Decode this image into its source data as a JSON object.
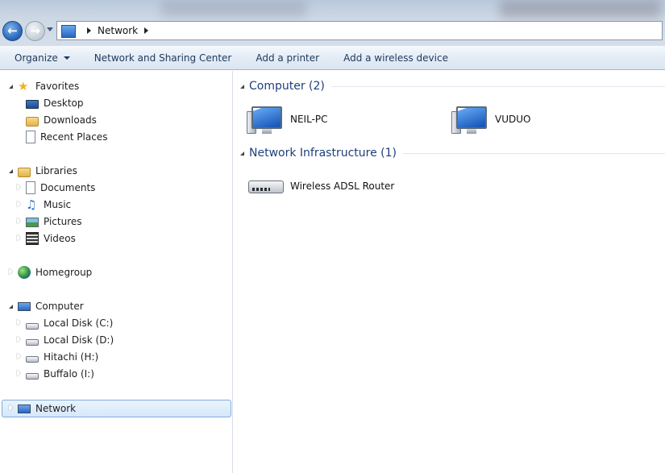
{
  "address": {
    "crumbs": [
      "Network"
    ]
  },
  "command_bar": {
    "organize": "Organize",
    "network_sharing": "Network and Sharing Center",
    "add_printer": "Add a printer",
    "add_wireless": "Add a wireless device"
  },
  "nav": {
    "favorites": "Favorites",
    "desktop": "Desktop",
    "downloads": "Downloads",
    "recent_places": "Recent Places",
    "libraries": "Libraries",
    "documents": "Documents",
    "music": "Music",
    "pictures": "Pictures",
    "videos": "Videos",
    "homegroup": "Homegroup",
    "computer": "Computer",
    "local_c": "Local Disk (C:)",
    "local_d": "Local Disk (D:)",
    "hitachi": "Hitachi (H:)",
    "buffalo": "Buffalo (I:)",
    "network": "Network"
  },
  "content": {
    "computer_group": "Computer (2)",
    "infra_group": "Network Infrastructure (1)",
    "computers": [
      "NEIL-PC",
      "VUDUO"
    ],
    "infrastructure": [
      "Wireless ADSL Router"
    ]
  },
  "colors": {
    "group_title": "#1e3f7a",
    "command_text": "#1e395b",
    "selection": "#d6e8fb"
  }
}
